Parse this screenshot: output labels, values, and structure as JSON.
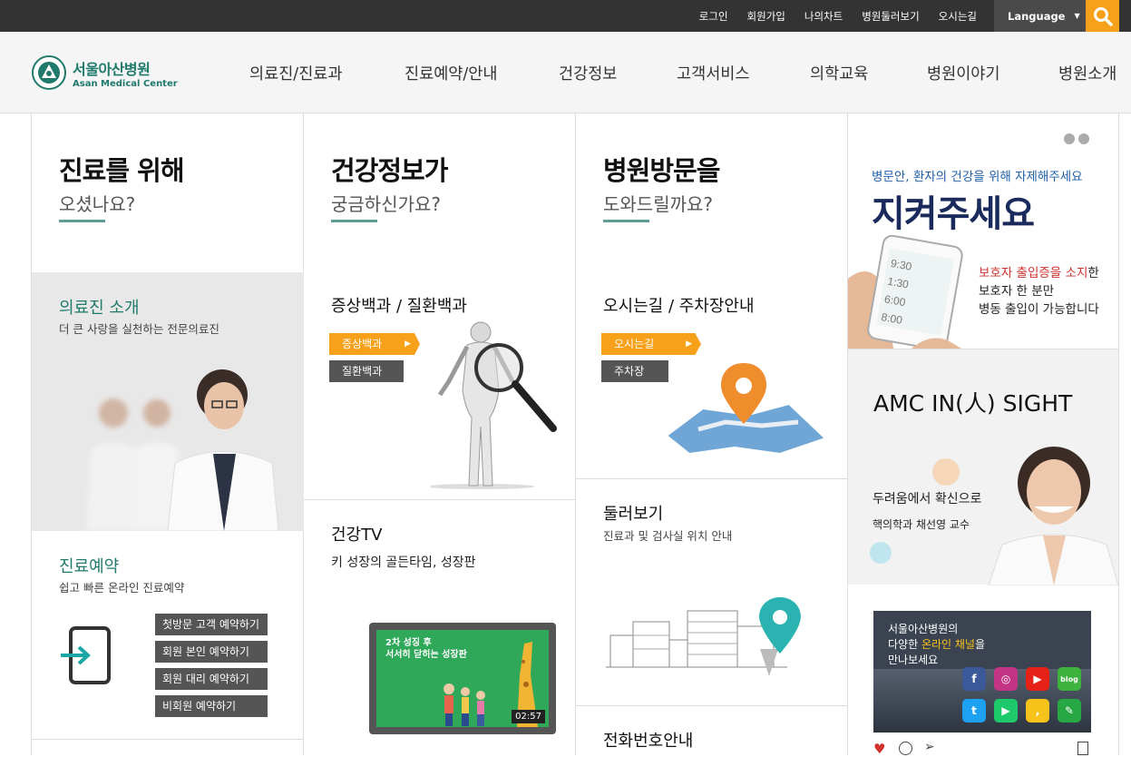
{
  "topbar": {
    "links": [
      "로그인",
      "회원가입",
      "나의차트",
      "병원둘러보기",
      "오시는길"
    ],
    "language": "Language"
  },
  "logo": {
    "ko": "서울아산병원",
    "en": "Asan Medical Center",
    "seal": "ASAN FOUNDATION"
  },
  "menu": [
    "의료진/진료과",
    "진료예약/안내",
    "건강정보",
    "고객서비스",
    "의학교육",
    "병원이야기",
    "병원소개"
  ],
  "col1": {
    "title": "진료를 위해",
    "subtitle": "오셨나요?",
    "staff": {
      "title": "의료진 소개",
      "desc": "더 큰 사랑을 실천하는 전문의료진"
    },
    "reserve": {
      "title": "진료예약",
      "desc": "쉽고 빠른 온라인 진료예약",
      "buttons": [
        "첫방문 고객 예약하기",
        "회원 본인 예약하기",
        "회원 대리 예약하기",
        "비회원 예약하기"
      ]
    }
  },
  "col2": {
    "title": "건강정보가",
    "subtitle": "궁금하신가요?",
    "encyc": {
      "title": "증상백과 / 질환백과",
      "btn1": "증상백과",
      "btn2": "질환백과"
    },
    "tv": {
      "title": "건강TV",
      "desc": "키 성장의 골든타임, 성장판",
      "video_caption_1": "2차 성징 후",
      "video_caption_2": "서서히 닫히는 성장판",
      "duration": "02:57"
    }
  },
  "col3": {
    "title": "병원방문을",
    "subtitle": "도와드릴까요?",
    "map": {
      "title": "오시는길 / 주차장안내",
      "btn1": "오시는길",
      "btn2": "주차장"
    },
    "tour": {
      "title": "둘러보기",
      "desc": "진료과 및 검사실 위치 안내"
    },
    "phone": {
      "title": "전화번호안내"
    }
  },
  "col4": {
    "banner": {
      "line1": "병문안, 환자의 건강을 위해 자제해주세요",
      "big": "지켜주세요",
      "n1a": "보호자 출입증을 소지",
      "n1b": "한",
      "n2": "보호자 한 분만",
      "n3": "병동 출입이 가능합니다"
    },
    "insight": {
      "title": "AMC IN(人) SIGHT",
      "l1": "두려움에서 확신으로",
      "l2": "핵의학과 채선영 교수"
    },
    "social": {
      "l1": "서울아산병원의",
      "l2a": "다양한 ",
      "l2b": "온라인 채널",
      "l2c": "을",
      "l3": "만나보세요",
      "blog": "blog"
    }
  },
  "colors": {
    "accent": "#f7a11a",
    "teal": "#1f7a6c",
    "dark": "#333333"
  }
}
